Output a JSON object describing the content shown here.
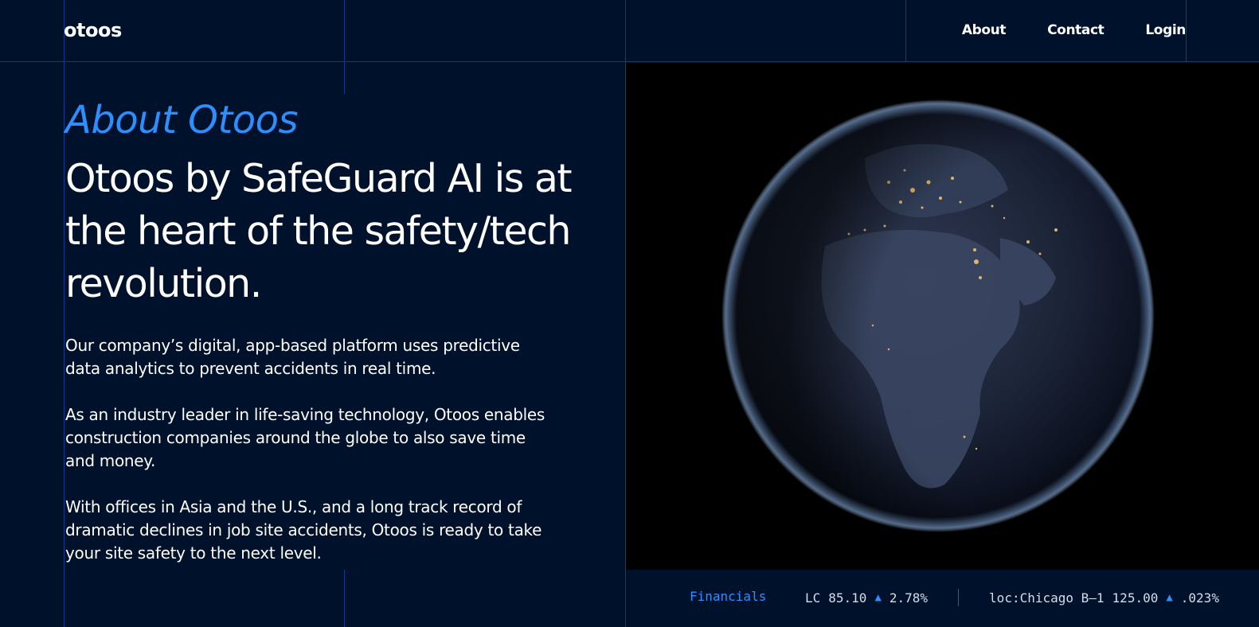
{
  "header": {
    "logo": "otoos",
    "nav": [
      {
        "label": "About"
      },
      {
        "label": "Contact"
      },
      {
        "label": "Login"
      }
    ]
  },
  "about": {
    "eyebrow": "About Otoos",
    "headline": "Otoos by SafeGuard AI is at the heart of the safety/tech revolution.",
    "paragraphs": [
      "Our company’s digital, app-based platform uses predictive data analytics to prevent accidents in real time.",
      "As an industry leader in life-saving technology, Otoos enables construction companies around the globe to also save time and money.",
      "With offices in Asia and the U.S., and a long track record of dramatic declines in job site accidents, Otoos is ready to take your site safety to the next level."
    ]
  },
  "ticker": {
    "label": "Financials",
    "items": [
      {
        "symbol": "LC",
        "value": "85.10",
        "change": "2.78%"
      },
      {
        "symbol": "loc:Chicago B–1",
        "value": "125.00",
        "change": ".023%"
      }
    ]
  },
  "colors": {
    "background": "#00112b",
    "accent": "#2d8fff",
    "gridline": "#0e3a8c"
  },
  "icons": [
    "arrow-up-icon",
    "earth-image"
  ]
}
